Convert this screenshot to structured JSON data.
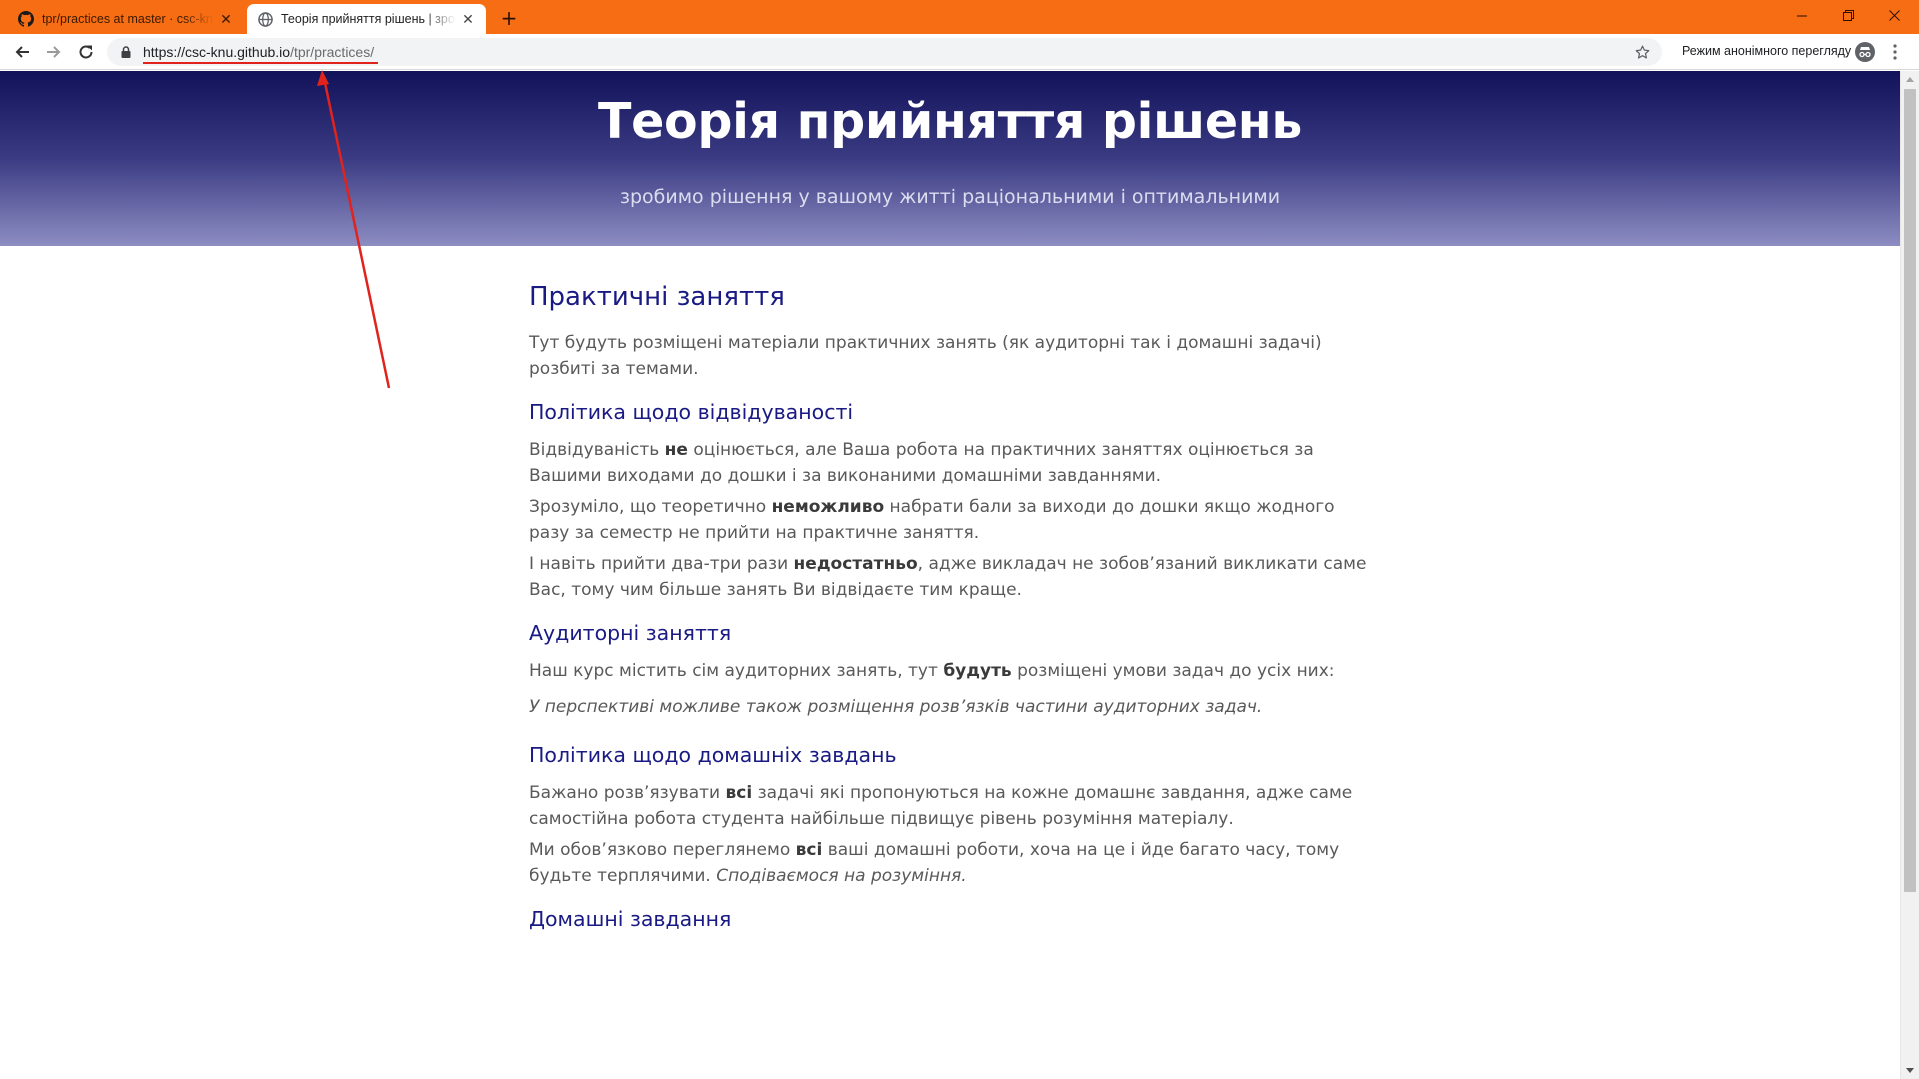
{
  "browser": {
    "tabs": [
      {
        "title": "tpr/practices at master · csc-knu/tpr",
        "icon": "github-icon",
        "active": false
      },
      {
        "title": "Теорія прийняття рішень | зробимо рішення у вашому житті",
        "icon": "globe-icon",
        "active": true
      }
    ],
    "new_tab_label": "+",
    "url": {
      "host_part": "https://csc-knu.github.io",
      "path_part": "/tpr/practices/"
    },
    "incognito_label": "Режим анонімного перегляду",
    "accent_color": "#f76d14",
    "annotation_color": "#e0231c"
  },
  "header": {
    "title": "Теорія прийняття рішень",
    "tagline": "зробимо рішення у вашому житті раціональними і оптимальними"
  },
  "main": {
    "h_practices": "Практичні заняття",
    "p_intro": "Тут будуть розміщені матеріали практичних занять (як аудиторні так і домашні задачі) розбиті за темами.",
    "h_attendance": "Політика щодо відвідуваності",
    "p_att1": {
      "a": "Відвідуваність ",
      "b": "не",
      "c": " оцінюється, але Ваша робота на практичних заняттях оцінюється за Вашими виходами до дошки і за виконаними домашніми завданнями."
    },
    "p_att2": {
      "a": "Зрозуміло, що теоретично ",
      "b": "неможливо",
      "c": " набрати бали за виходи до дошки якщо жодного разу за семестр не прийти на практичне заняття."
    },
    "p_att3": {
      "a": "І навіть прийти два-три рази ",
      "b": "недостатньо",
      "c": ", адже викладач не зобов’язаний викликати саме Вас, тому чим більше занять Ви відвідаєте тим краще."
    },
    "h_classroom": "Аудиторні заняття",
    "p_class1": {
      "a": "Наш курс містить сім аудиторних занять, тут ",
      "b": "будуть",
      "c": " розміщені умови задач до усіх них:"
    },
    "p_class2": "У перспективі можливе також розміщення розв’язків частини аудиторних задач.",
    "h_homework_policy": "Політика щодо домашніх завдань",
    "p_hw1": {
      "a": "Бажано розв’язувати ",
      "b": "всі",
      "c": " задачі які пропонуються на кожне домашнє завдання, адже саме самостійна робота студента найбільше підвищує рівень розуміння матеріалу."
    },
    "p_hw2": {
      "a": "Ми обов’язково переглянемо ",
      "b": "всі",
      "c": " ваші домашні роботи, хоча на це і йде багато часу, тому будьте терплячими. ",
      "d": "Сподіваємося на розуміння."
    },
    "h_homework": "Домашні завдання"
  }
}
